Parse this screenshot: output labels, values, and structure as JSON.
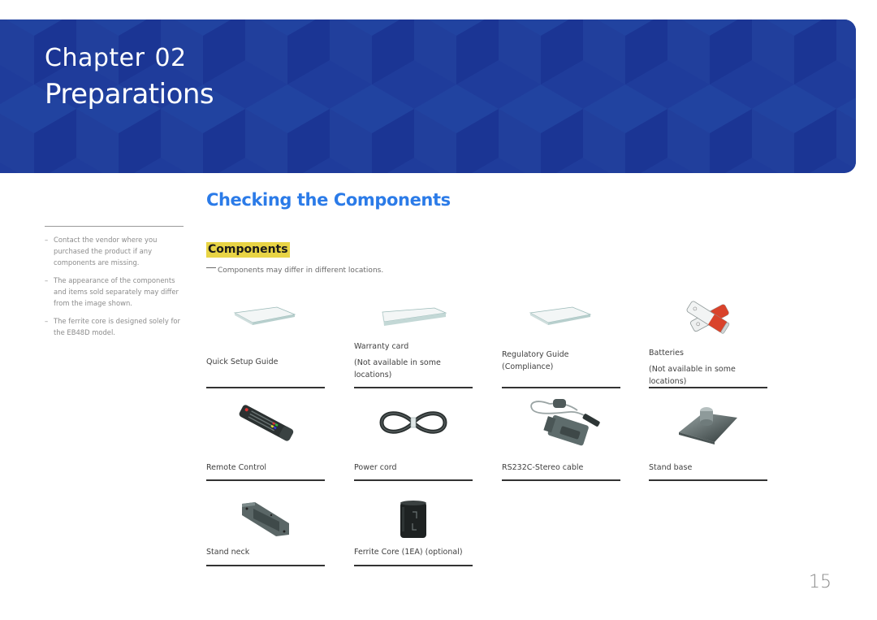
{
  "banner": {
    "chapter_label": "Chapter",
    "chapter_number": "02",
    "title": "Preparations",
    "color": "#1f3c9b"
  },
  "sidebar": {
    "notes": [
      "Contact the vendor where you purchased the product if any components are missing.",
      "The appearance of the components and items sold separately may differ from the image shown.",
      "The ferrite core is designed solely for the EB48D model."
    ]
  },
  "main": {
    "heading": "Checking the Components",
    "subheading": "Components",
    "note": "Components may differ in different locations.",
    "items": [
      {
        "label": "Quick Setup Guide",
        "sub": "",
        "icon": "booklet-icon"
      },
      {
        "label": "Warranty card",
        "sub": "(Not available in some locations)",
        "icon": "warranty-card-icon"
      },
      {
        "label": "Regulatory Guide (Compliance)",
        "sub": "",
        "icon": "regulatory-guide-icon"
      },
      {
        "label": "Batteries",
        "sub": "(Not available in some locations)",
        "icon": "batteries-icon"
      },
      {
        "label": "Remote Control",
        "sub": "",
        "icon": "remote-control-icon"
      },
      {
        "label": "Power cord",
        "sub": "",
        "icon": "power-cord-icon"
      },
      {
        "label": "RS232C-Stereo cable",
        "sub": "",
        "icon": "rs232c-cable-icon"
      },
      {
        "label": "Stand base",
        "sub": "",
        "icon": "stand-base-icon"
      },
      {
        "label": "Stand neck",
        "sub": "",
        "icon": "stand-neck-icon"
      },
      {
        "label": "Ferrite Core (1EA) (optional)",
        "sub": "",
        "icon": "ferrite-core-icon"
      }
    ]
  },
  "page_number": "15"
}
